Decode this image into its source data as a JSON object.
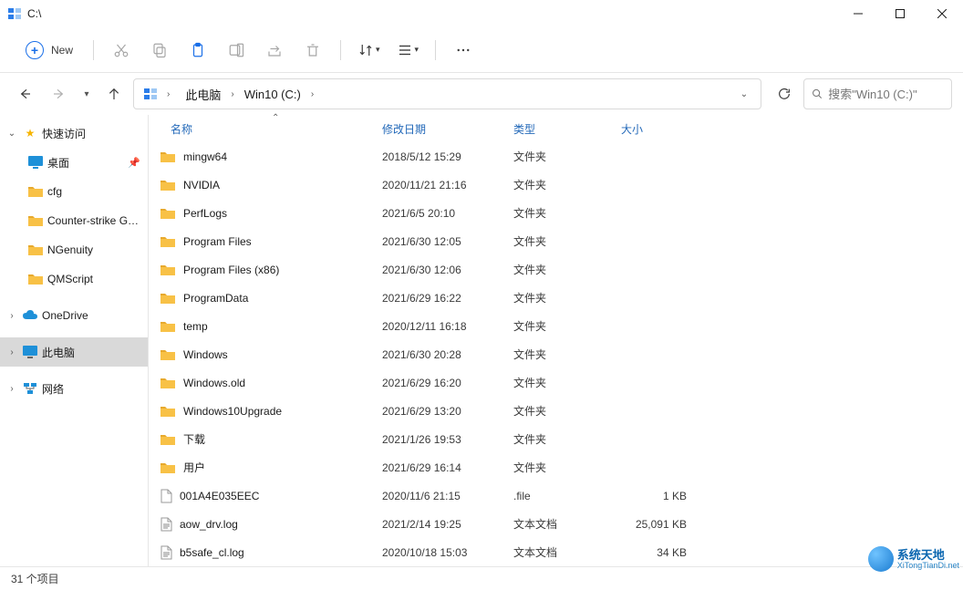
{
  "title": "C:\\",
  "toolbar": {
    "new_label": "New"
  },
  "breadcrumb": {
    "root": "此电脑",
    "drive": "Win10 (C:)"
  },
  "search": {
    "placeholder": "搜索\"Win10 (C:)\""
  },
  "sidebar": {
    "quick_access": "快速访问",
    "desktop": "桌面",
    "cfg": "cfg",
    "csg": "Counter-strike  G…",
    "ngenuity": "NGenuity",
    "qmscript": "QMScript",
    "onedrive": "OneDrive",
    "thispc": "此电脑",
    "network": "网络"
  },
  "columns": {
    "name": "名称",
    "date": "修改日期",
    "type": "类型",
    "size": "大小"
  },
  "files": [
    {
      "name": "mingw64",
      "date": "2018/5/12 15:29",
      "type": "文件夹",
      "size": "",
      "kind": "folder"
    },
    {
      "name": "NVIDIA",
      "date": "2020/11/21 21:16",
      "type": "文件夹",
      "size": "",
      "kind": "folder"
    },
    {
      "name": "PerfLogs",
      "date": "2021/6/5 20:10",
      "type": "文件夹",
      "size": "",
      "kind": "folder"
    },
    {
      "name": "Program Files",
      "date": "2021/6/30 12:05",
      "type": "文件夹",
      "size": "",
      "kind": "folder"
    },
    {
      "name": "Program Files (x86)",
      "date": "2021/6/30 12:06",
      "type": "文件夹",
      "size": "",
      "kind": "folder"
    },
    {
      "name": "ProgramData",
      "date": "2021/6/29 16:22",
      "type": "文件夹",
      "size": "",
      "kind": "folder"
    },
    {
      "name": "temp",
      "date": "2020/12/11 16:18",
      "type": "文件夹",
      "size": "",
      "kind": "folder"
    },
    {
      "name": "Windows",
      "date": "2021/6/30 20:28",
      "type": "文件夹",
      "size": "",
      "kind": "folder"
    },
    {
      "name": "Windows.old",
      "date": "2021/6/29 16:20",
      "type": "文件夹",
      "size": "",
      "kind": "folder"
    },
    {
      "name": "Windows10Upgrade",
      "date": "2021/6/29 13:20",
      "type": "文件夹",
      "size": "",
      "kind": "folder"
    },
    {
      "name": "下载",
      "date": "2021/1/26 19:53",
      "type": "文件夹",
      "size": "",
      "kind": "folder"
    },
    {
      "name": "用户",
      "date": "2021/6/29 16:14",
      "type": "文件夹",
      "size": "",
      "kind": "folder"
    },
    {
      "name": "001A4E035EEC",
      "date": "2020/11/6 21:15",
      "type": ".file",
      "size": "1 KB",
      "kind": "file"
    },
    {
      "name": "aow_drv.log",
      "date": "2021/2/14 19:25",
      "type": "文本文档",
      "size": "25,091 KB",
      "kind": "txt"
    },
    {
      "name": "b5safe_cl.log",
      "date": "2020/10/18 15:03",
      "type": "文本文档",
      "size": "34 KB",
      "kind": "txt"
    }
  ],
  "status": {
    "count_label": "31 个项目"
  },
  "watermark": {
    "cn": "系统天地",
    "en": "XiTongTianDi.net"
  }
}
